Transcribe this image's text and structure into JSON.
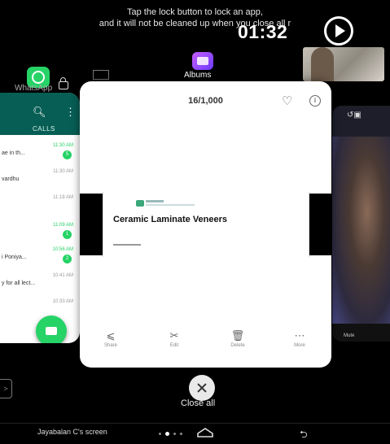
{
  "overlay": {
    "hint_line1": "Tap the lock button to lock an app,",
    "hint_line2": "and it will not be cleaned up when you close all r",
    "timer": "01:32"
  },
  "apps": {
    "whatsapp_label": "WhatsApp",
    "albums_label": "Albums"
  },
  "whatsapp": {
    "tab_label": "CALLS",
    "rows": [
      {
        "time": "11:30 AM",
        "text": "ae in th...",
        "badge": "5",
        "time_color": "green"
      },
      {
        "time": "11:30 AM",
        "text": "vardhu",
        "badge": "",
        "time_color": "grey"
      },
      {
        "time": "11:18 AM",
        "text": "",
        "badge": "",
        "time_color": "grey"
      },
      {
        "time": "11:09 AM",
        "text": "",
        "badge": "1",
        "time_color": "green"
      },
      {
        "time": "10:56 AM",
        "text": "i Poniya...",
        "badge": "2",
        "time_color": "green"
      },
      {
        "time": "10:41 AM",
        "text": "y for all lect...",
        "badge": "",
        "time_color": "grey"
      },
      {
        "time": "10:33 AM",
        "text": "",
        "badge": "",
        "time_color": "grey"
      }
    ]
  },
  "albums": {
    "counter": "16/1,000",
    "document_title": "Ceramic Laminate Veneers",
    "actions": [
      {
        "icon": "share-icon",
        "label": "Share"
      },
      {
        "icon": "edit-icon",
        "label": "Edit"
      },
      {
        "icon": "delete-icon",
        "label": "Delete"
      },
      {
        "icon": "more-icon",
        "label": "More"
      }
    ]
  },
  "video_card": {
    "mute_label": "Mute"
  },
  "recents": {
    "close_all_label": "Close all"
  },
  "bottom": {
    "screen_label": "Jayabalan C's screen"
  }
}
